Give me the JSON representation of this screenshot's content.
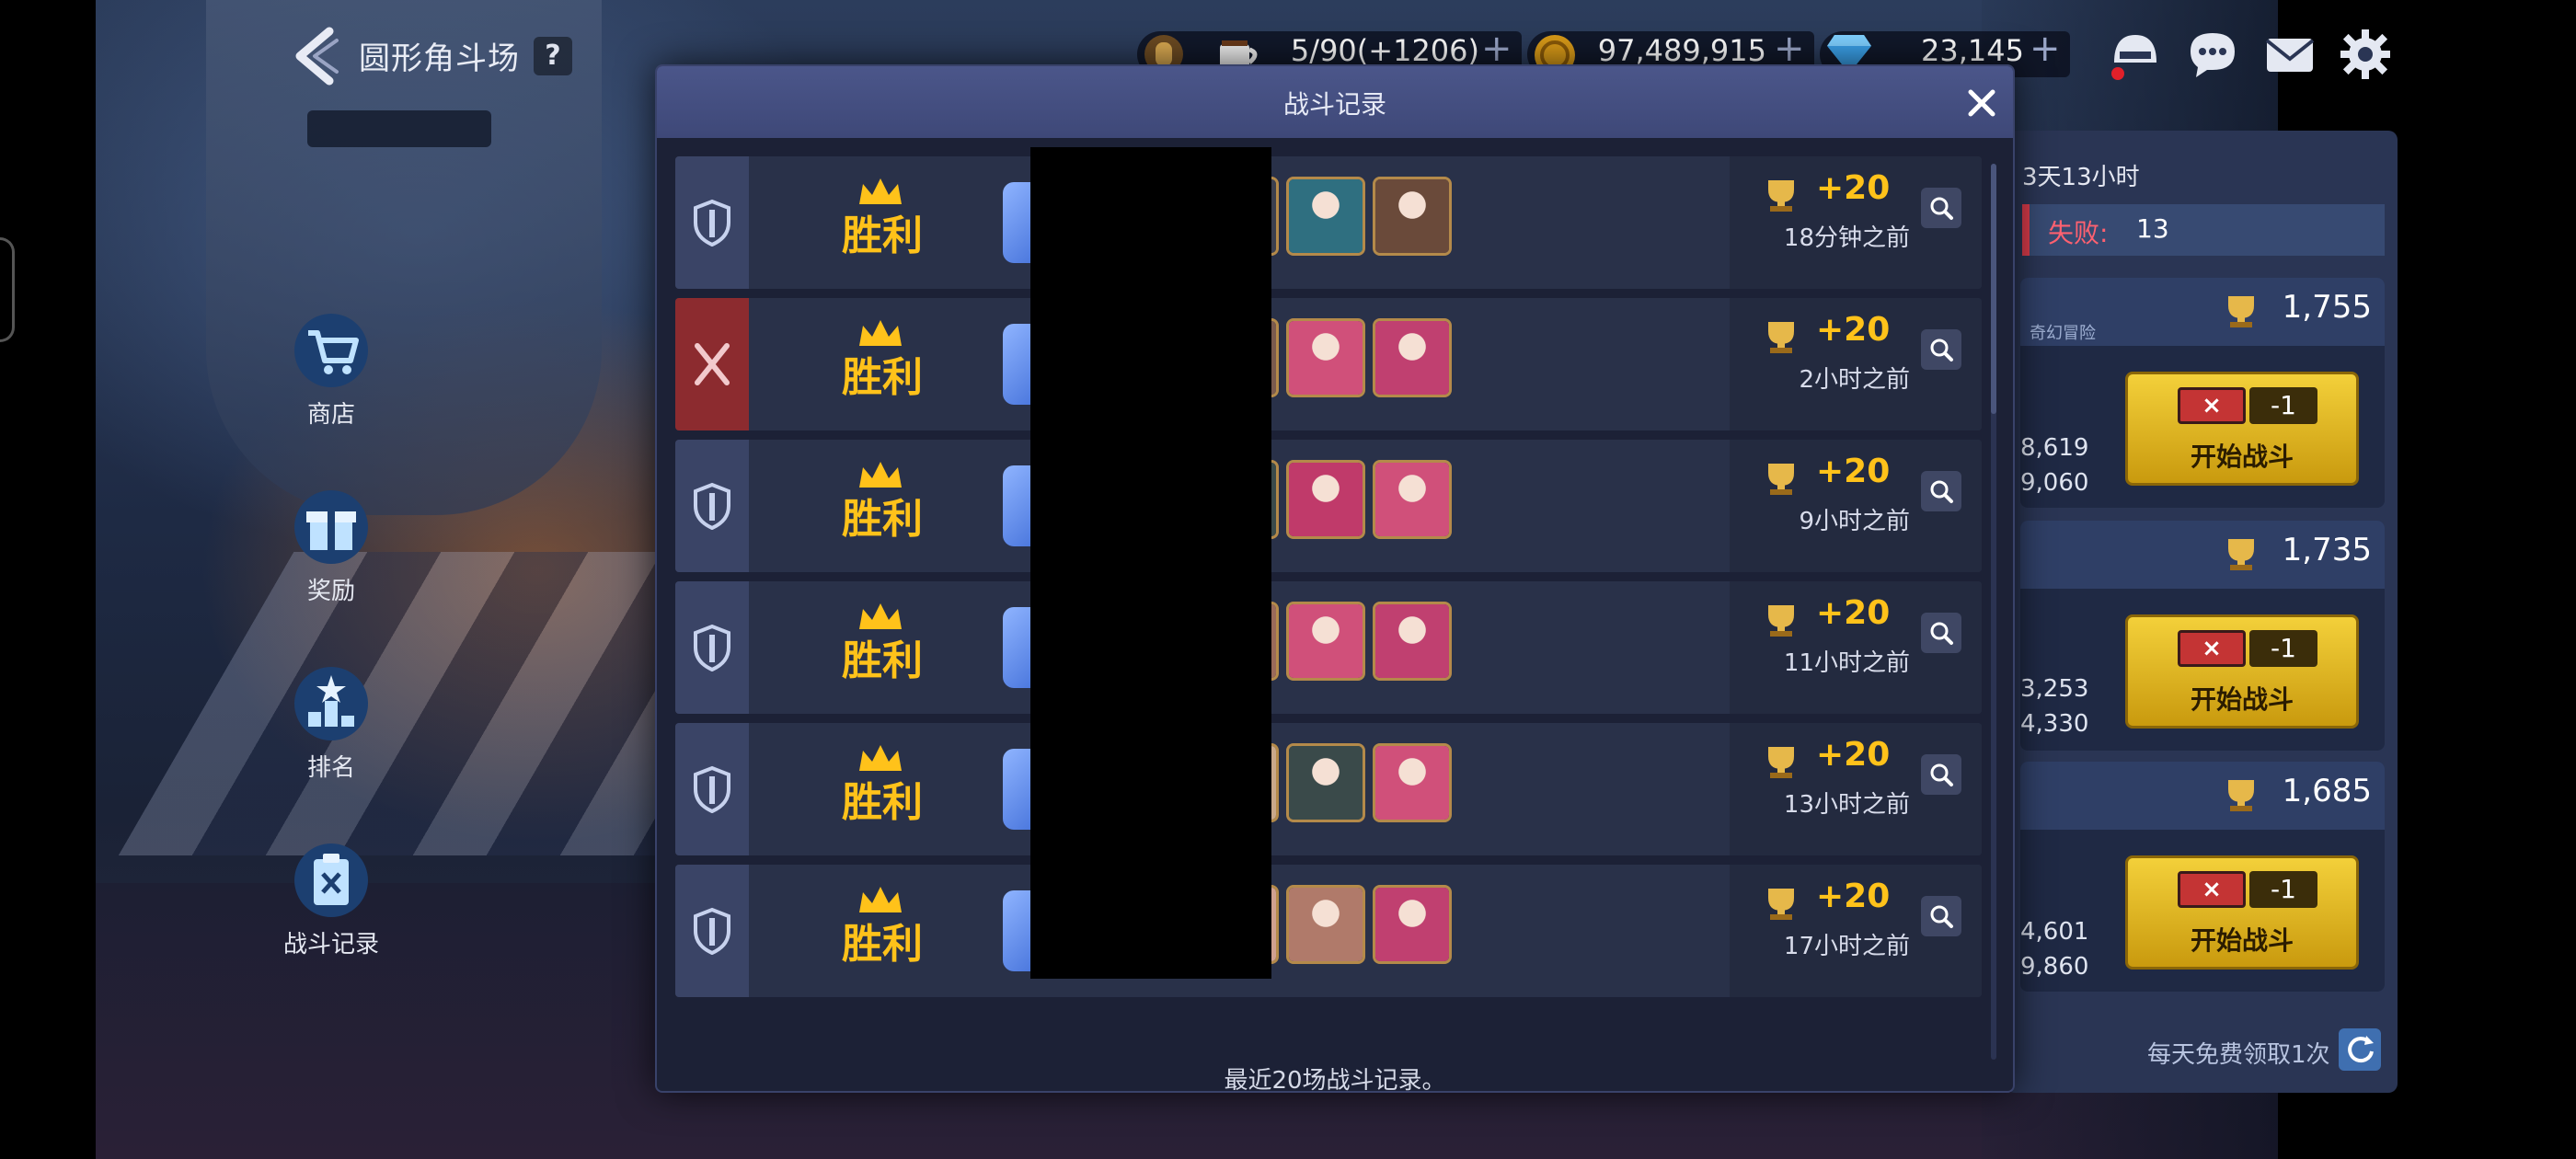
{
  "header": {
    "title": "圆形角斗场",
    "help_label": "?"
  },
  "resources": {
    "stamina": "5/90(+1206)",
    "gold": "97,489,915",
    "gems": "23,145",
    "plus": "+"
  },
  "menu": {
    "items": [
      {
        "label": "商店",
        "icon": "shop-cart-icon"
      },
      {
        "label": "奖励",
        "icon": "gift-icon"
      },
      {
        "label": "排名",
        "icon": "ranking-icon"
      },
      {
        "label": "战斗记录",
        "icon": "battle-record-icon"
      }
    ]
  },
  "side_panel": {
    "season_timer": "3天13小时",
    "loss_label": "失败:",
    "loss_value": "13",
    "opponent_tag": "奇幻冒险",
    "opponents": [
      {
        "points": "1,755",
        "stat_a": "8,619",
        "stat_b": "9,060",
        "cost": "-1",
        "ticket_x": "×",
        "button": "开始战斗"
      },
      {
        "points": "1,735",
        "stat_a": "3,253",
        "stat_b": "4,330",
        "cost": "-1",
        "ticket_x": "×",
        "button": "开始战斗"
      },
      {
        "points": "1,685",
        "stat_a": "4,601",
        "stat_b": "9,860",
        "cost": "-1",
        "ticket_x": "×",
        "button": "开始战斗"
      }
    ],
    "daily_free": "每天免费领取1次"
  },
  "modal": {
    "title": "战斗记录",
    "footer": "最近20场战斗记录。",
    "records": [
      {
        "type": "defense",
        "result": "胜利",
        "points": "+20",
        "time": "18分钟之前",
        "heroes": [
          "#5aa0e6",
          "#3b3f4e",
          "#2f6f80",
          "#6a4a3a"
        ]
      },
      {
        "type": "attack",
        "result": "胜利",
        "points": "+20",
        "time": "2小时之前",
        "heroes": [
          "#e8c05a",
          "#7a5a4e",
          "#d0507a",
          "#c04070"
        ]
      },
      {
        "type": "defense",
        "result": "胜利",
        "points": "+20",
        "time": "9小时之前",
        "heroes": [
          "#c9a88a",
          "#3a4a4a",
          "#c03a6a",
          "#d0507a"
        ]
      },
      {
        "type": "defense",
        "result": "胜利",
        "points": "+20",
        "time": "11小时之前",
        "heroes": [
          "#c9a88a",
          "#9a6a5a",
          "#d0507a",
          "#c04070"
        ]
      },
      {
        "type": "defense",
        "result": "胜利",
        "points": "+20",
        "time": "13小时之前",
        "heroes": [
          "#5aa0e6",
          "#c9a88a",
          "#3a4a4a",
          "#d0507a"
        ]
      },
      {
        "type": "defense",
        "result": "胜利",
        "points": "+20",
        "time": "17小时之前",
        "heroes": [
          "#3a4a4a",
          "#d0a090",
          "#b07a6a",
          "#c04070"
        ]
      }
    ]
  },
  "colors": {
    "victory_gold": "#ffc21a",
    "attack_red": "#8c2b2f",
    "defense_slate": "#3a4466",
    "start_button": "#f3d03a"
  }
}
